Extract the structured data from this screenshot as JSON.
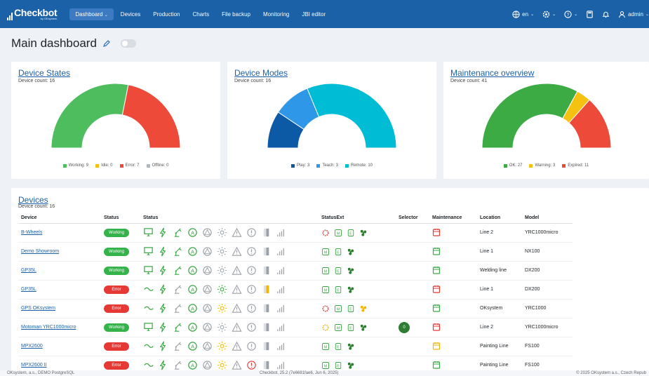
{
  "brand": {
    "name": "Checkbot",
    "sub": "by OKsystem"
  },
  "nav": {
    "items": [
      "Dashboard",
      "Devices",
      "Production",
      "Charts",
      "File backup",
      "Monitoring",
      "JBI editor"
    ],
    "lang": "en",
    "user": "admin"
  },
  "page": {
    "title": "Main dashboard"
  },
  "cards": [
    {
      "title": "Device States",
      "count": "Device count: 16",
      "legend": [
        {
          "label": "Working: 9",
          "color": "#4dbd5e"
        },
        {
          "label": "Idle: 0",
          "color": "#f5c211"
        },
        {
          "label": "Error: 7",
          "color": "#ee4a3a"
        },
        {
          "label": "Offline: 0",
          "color": "#b0b6bd"
        }
      ]
    },
    {
      "title": "Device Modes",
      "count": "Device count: 16",
      "legend": [
        {
          "label": "Play: 3",
          "color": "#0c59a6"
        },
        {
          "label": "Teach: 3",
          "color": "#2f97e8"
        },
        {
          "label": "Remote: 10",
          "color": "#00bcd4"
        }
      ]
    },
    {
      "title": "Maintenance overview",
      "count": "Device count: 41",
      "legend": [
        {
          "label": "OK: 27",
          "color": "#3cab44"
        },
        {
          "label": "Warning: 3",
          "color": "#f5c211"
        },
        {
          "label": "Expired: 11",
          "color": "#ee4a3a"
        }
      ]
    }
  ],
  "chart_data": [
    {
      "type": "pie",
      "title": "Device States",
      "categories": [
        "Working",
        "Idle",
        "Error",
        "Offline"
      ],
      "values": [
        9,
        0,
        7,
        0
      ],
      "colors": [
        "#4dbd5e",
        "#f5c211",
        "#ee4a3a",
        "#b0b6bd"
      ]
    },
    {
      "type": "pie",
      "title": "Device Modes",
      "categories": [
        "Play",
        "Teach",
        "Remote"
      ],
      "values": [
        3,
        3,
        10
      ],
      "colors": [
        "#0c59a6",
        "#2f97e8",
        "#00bcd4"
      ]
    },
    {
      "type": "pie",
      "title": "Maintenance overview",
      "categories": [
        "OK",
        "Warning",
        "Expired"
      ],
      "values": [
        27,
        3,
        11
      ],
      "colors": [
        "#3cab44",
        "#f5c211",
        "#ee4a3a"
      ]
    }
  ],
  "devices": {
    "title": "Devices",
    "count": "Device count: 16",
    "columns": [
      "Device",
      "Status",
      "Status",
      "StatusExt",
      "Selector",
      "Maintenance",
      "Location",
      "Model"
    ],
    "rows": [
      {
        "device": "B-Wheels",
        "status": "Working",
        "location": "Line 2",
        "model": "YRC1000micro",
        "selector": "",
        "maint": "red"
      },
      {
        "device": "Demo Showroom",
        "status": "Working",
        "location": "Line 1",
        "model": "NX100",
        "selector": "",
        "maint": "green"
      },
      {
        "device": "GP35L",
        "status": "Working",
        "location": "Welding line",
        "model": "DX200",
        "selector": "",
        "maint": "green"
      },
      {
        "device": "GP35L",
        "status": "Error",
        "location": "Line 1",
        "model": "DX200",
        "selector": "",
        "maint": "red"
      },
      {
        "device": "GPS OKsystem",
        "status": "Error",
        "location": "OKsystem",
        "model": "YRC1000",
        "selector": "",
        "maint": "green"
      },
      {
        "device": "Motoman YRC1000micro",
        "status": "Working",
        "location": "Line 2",
        "model": "YRC1000micro",
        "selector": "0",
        "maint": "red"
      },
      {
        "device": "MPX2600",
        "status": "Error",
        "location": "Painting Line",
        "model": "FS100",
        "selector": "",
        "maint": "yellow"
      },
      {
        "device": "MPX2600 II",
        "status": "Error",
        "location": "Painting Line",
        "model": "FS100",
        "selector": "",
        "maint": "green"
      }
    ]
  },
  "footer": {
    "left": "OKsystem, a.s., DEMO PostgreSQL",
    "center": "Checkbot, 25.2 (7e6681fae6, Jun 6, 2025)",
    "right": "© 2025 OKsystem a.s., Czech Repub"
  }
}
